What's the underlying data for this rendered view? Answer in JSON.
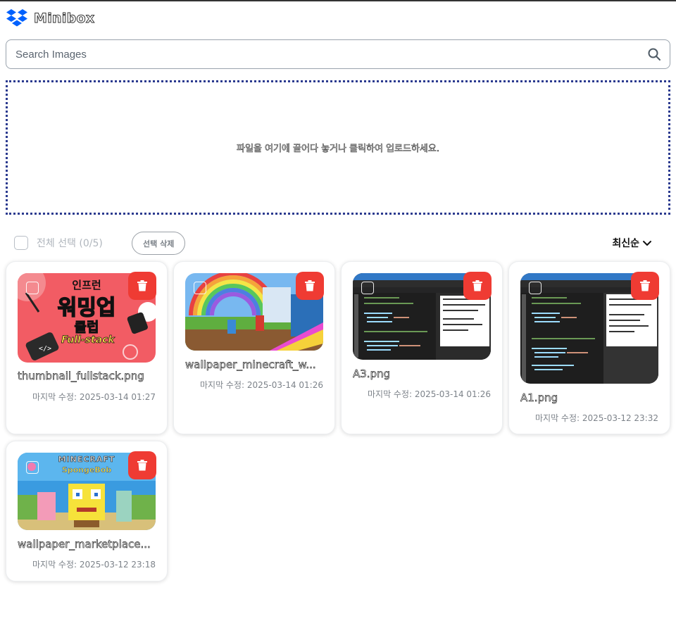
{
  "app": {
    "name": "Minibox"
  },
  "search": {
    "placeholder": "Search Images",
    "value": ""
  },
  "dropzone": {
    "text": "파일을 여기에 끌어다 놓거나 클릭하여 업로드하세요."
  },
  "toolbar": {
    "select_all_label": "전체 선택 (0/5)",
    "delete_selected_label": "선택 삭제",
    "sort_label": "최신순"
  },
  "files": [
    {
      "name": "thumbnail_fullstack.png",
      "modified": "마지막 수정: 2025-03-14 01:27",
      "thumb_text": [
        "인프런",
        "워밍업",
        "클럽",
        "Full-stack"
      ]
    },
    {
      "name": "wallpaper_minecraft_w...",
      "modified": "마지막 수정: 2025-03-14 01:26"
    },
    {
      "name": "A3.png",
      "modified": "마지막 수정: 2025-03-14 01:26"
    },
    {
      "name": "A1.png",
      "modified": "마지막 수정: 2025-03-12 23:32"
    },
    {
      "name": "wallpaper_marketplace...",
      "modified": "마지막 수정: 2025-03-12 23:18",
      "thumb_text": [
        "MINECRAFT",
        "SpongeBob"
      ]
    }
  ],
  "icons": {
    "logo": "dropbox-logo-icon",
    "search": "search-icon",
    "sort": "chevron-down-icon",
    "delete": "trash-icon"
  },
  "colors": {
    "accent_blue": "#0061fe",
    "dropzone_border": "#2b3a8f",
    "delete_red": "#ef3b33",
    "thumb_pink": "#f25c64"
  }
}
